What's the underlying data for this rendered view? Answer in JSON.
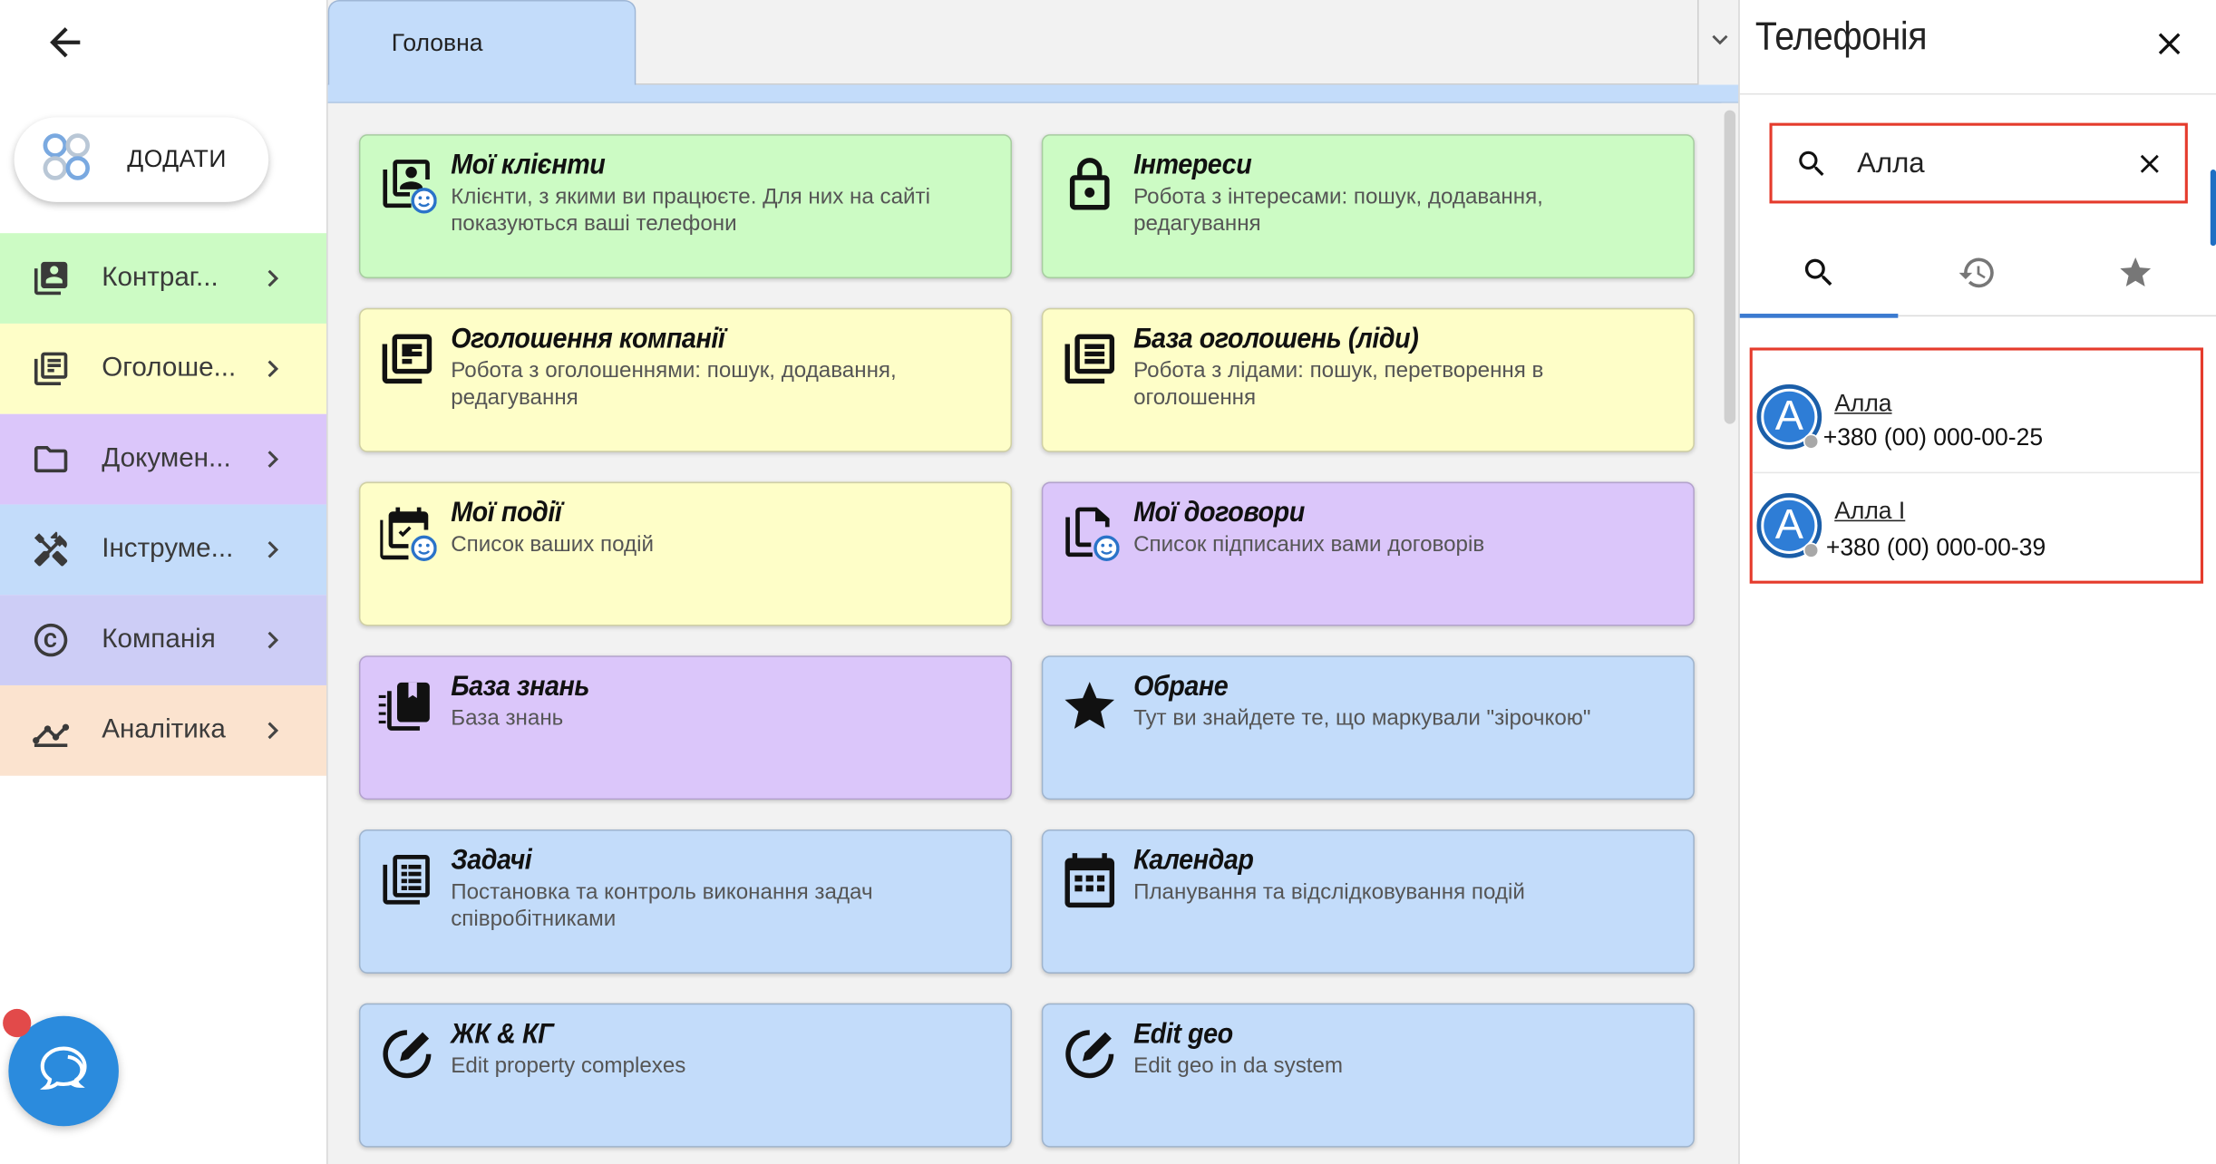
{
  "sidebar": {
    "add_label": "ДОДАТИ",
    "items": [
      {
        "label": "Контраг...",
        "icon": "contacts-icon",
        "color": "#ccfbc4"
      },
      {
        "label": "Оголоше...",
        "icon": "listings-icon",
        "color": "#fefec8"
      },
      {
        "label": "Докумен...",
        "icon": "folder-icon",
        "color": "#dbc6fa"
      },
      {
        "label": "Інструме...",
        "icon": "tools-icon",
        "color": "#c3dcfa"
      },
      {
        "label": "Компанія",
        "icon": "copyright-icon",
        "color": "#cdcdf6"
      },
      {
        "label": "Аналітика",
        "icon": "analytics-icon",
        "color": "#fbe3cf"
      }
    ]
  },
  "main": {
    "tab_label": "Головна",
    "cards": [
      {
        "title": "Мої клієнти",
        "desc": "Клієнти, з якими ви працюєте. Для них на сайті показуються ваші телефони",
        "color": "green",
        "icon": "my-clients-icon"
      },
      {
        "title": "Інтереси",
        "desc": "Робота з інтересами: пошук, додавання, редагування",
        "color": "green",
        "icon": "lock-icon"
      },
      {
        "title": "Оголошення компанії",
        "desc": "Робота з оголошеннями: пошук, додавання, редагування",
        "color": "yellow",
        "icon": "company-listings-icon"
      },
      {
        "title": "База оголошень (ліди)",
        "desc": "Робота з лідами: пошук, перетворення в оголошення",
        "color": "yellow",
        "icon": "leads-base-icon"
      },
      {
        "title": "Мої події",
        "desc": "Список ваших подій",
        "color": "yellow",
        "icon": "my-events-icon"
      },
      {
        "title": "Мої договори",
        "desc": "Список підписаних вами договорів",
        "color": "purple",
        "icon": "my-contracts-icon"
      },
      {
        "title": "База знань",
        "desc": "База знань",
        "color": "purple",
        "icon": "knowledge-base-icon"
      },
      {
        "title": "Обране",
        "desc": "Тут ви знайдете те, що маркували \"зірочкою\"",
        "color": "blue",
        "icon": "star-icon"
      },
      {
        "title": "Задачі",
        "desc": "Постановка та контроль виконання задач співробітниками",
        "color": "blue",
        "icon": "tasks-icon"
      },
      {
        "title": "Календар",
        "desc": "Планування та відслідковування подій",
        "color": "blue",
        "icon": "calendar-icon"
      },
      {
        "title": "ЖК & КГ",
        "desc": "Edit property complexes",
        "color": "blue",
        "icon": "edit-icon"
      },
      {
        "title": "Edit geo",
        "desc": "Edit geo in da system",
        "color": "blue",
        "icon": "edit-icon"
      }
    ]
  },
  "panel": {
    "title": "Телефонія",
    "search_value": "Алла",
    "results": [
      {
        "name": "Алла",
        "phone": "+380 (00) 000-00-25",
        "avatar": "A"
      },
      {
        "name": "Алла І",
        "phone": "+380 (00) 000-00-39",
        "avatar": "A"
      }
    ]
  },
  "colors": {
    "accent": "#3b7ad0",
    "highlight_border": "#e53b2c",
    "chat": "#2b8bdd"
  }
}
